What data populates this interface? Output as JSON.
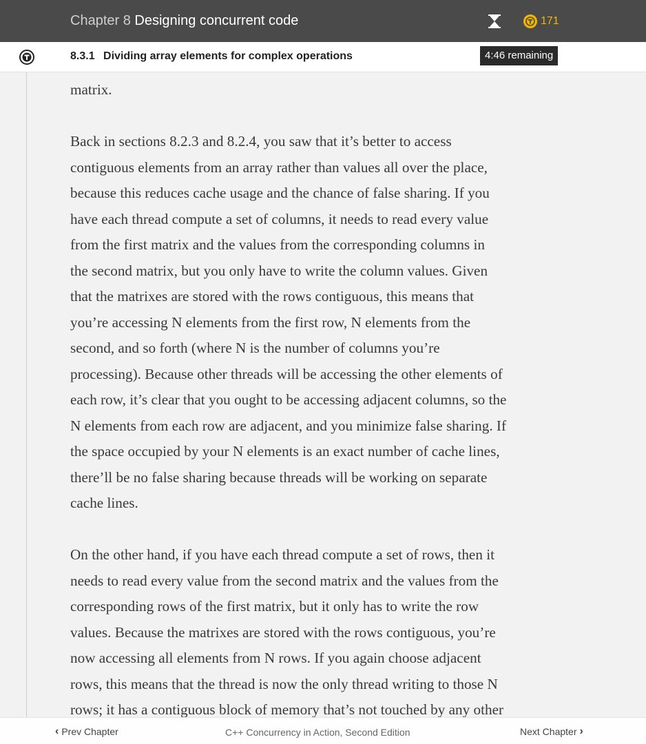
{
  "header": {
    "chapter_label": "Chapter 8",
    "chapter_title": "Designing concurrent code",
    "token_count": "171"
  },
  "subheader": {
    "section_number": "8.3.1",
    "section_title": "Dividing array elements for complex operations",
    "time_remaining": "4:46 remaining"
  },
  "content": {
    "lines": [
      "matrix.",
      "",
      "Back in sections 8.2.3 and 8.2.4, you saw that it’s better to access",
      "contiguous elements from an array rather than values all over the place,",
      "because this reduces cache usage and the chance of false sharing. If you",
      "have each thread compute a set of columns, it needs to read every value",
      "from the first matrix and the values from the corresponding columns in",
      "the second matrix, but you only have to write the column values. Given",
      "that the matrixes are stored with the rows contiguous, this means that",
      "you’re accessing N elements from the first row, N elements from the",
      "second, and so forth (where N is the number of columns you’re",
      "processing). Because other threads will be accessing the other elements of",
      "each row, it’s clear that you ought to be accessing adjacent columns, so the",
      "N elements from each row are adjacent, and you minimize false sharing. If",
      "the space occupied by your N elements is an exact number of cache lines,",
      "there’ll be no false sharing because threads will be working on separate",
      "cache lines.",
      "",
      "On the other hand, if you have each thread compute a set of rows, then it",
      "needs to read every value from the second matrix and the values from the",
      "corresponding rows of the first matrix, but it only has to write the row",
      "values. Because the matrixes are stored with the rows contiguous, you’re",
      "now accessing all elements from N rows. If you again choose adjacent",
      "rows, this means that the thread is now the only thread writing to those N",
      "rows; it has a contiguous block of memory that’s not touched by any other"
    ]
  },
  "footer": {
    "prev_label": "Prev Chapter",
    "book_title": "C++ Concurrency in Action, Second Edition",
    "next_label": "Next Chapter"
  },
  "colors": {
    "header_bg": "#4a4a4a",
    "accent_gold": "#f5b400",
    "text": "#3a3a3a",
    "page_bg": "#f2f2f2"
  }
}
